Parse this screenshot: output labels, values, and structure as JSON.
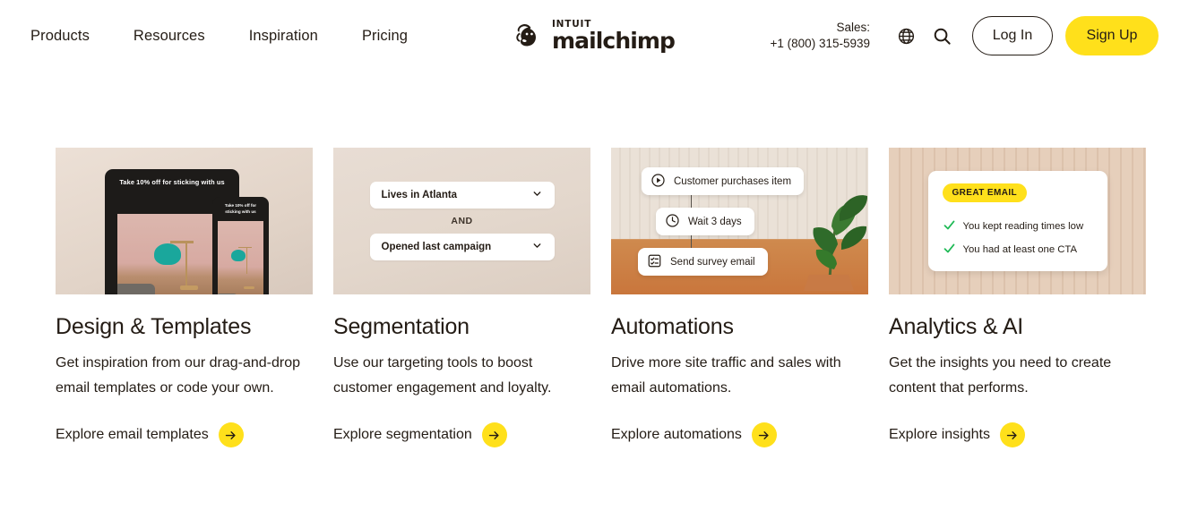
{
  "header": {
    "nav_links": [
      {
        "label": "Products"
      },
      {
        "label": "Resources"
      },
      {
        "label": "Inspiration"
      },
      {
        "label": "Pricing"
      }
    ],
    "logo": {
      "intuit": "INTUIT",
      "name": "mailchimp"
    },
    "sales": {
      "label": "Sales:",
      "phone": "+1 (800) 315-5939"
    },
    "icons": {
      "globe": "globe-icon",
      "search": "search-icon"
    },
    "login_label": "Log In",
    "signup_label": "Sign Up"
  },
  "colors": {
    "brand_yellow": "#ffe01b",
    "ink": "#241c15",
    "check_green": "#1eb955"
  },
  "cards": [
    {
      "title": "Design & Templates",
      "desc": "Get inspiration from our drag-and-drop email templates or code your own.",
      "cta": "Explore email templates",
      "media": {
        "kind": "device-mockup",
        "tablet_headline": "Take 10% off for sticking with us",
        "phone_headline": "Take 10% off for sticking with us"
      }
    },
    {
      "title": "Segmentation",
      "desc": "Use our targeting tools to boost customer engagement and loyalty.",
      "cta": "Explore segmentation",
      "media": {
        "kind": "segment-builder",
        "condition_one": "Lives in Atlanta",
        "operator": "AND",
        "condition_two": "Opened last campaign"
      }
    },
    {
      "title": "Automations",
      "desc": "Drive more site traffic and sales with email automations.",
      "cta": "Explore automations",
      "media": {
        "kind": "automation-flow",
        "steps": [
          {
            "icon": "play-circle-icon",
            "label": "Customer purchases item"
          },
          {
            "icon": "clock-icon",
            "label": "Wait 3 days"
          },
          {
            "icon": "checklist-icon",
            "label": "Send survey email"
          }
        ]
      }
    },
    {
      "title": "Analytics & AI",
      "desc": "Get the insights you need to create content that performs.",
      "cta": "Explore insights",
      "media": {
        "kind": "insight-card",
        "badge": "GREAT EMAIL",
        "checks": [
          "You kept reading times low",
          "You had at least one CTA"
        ]
      }
    }
  ]
}
